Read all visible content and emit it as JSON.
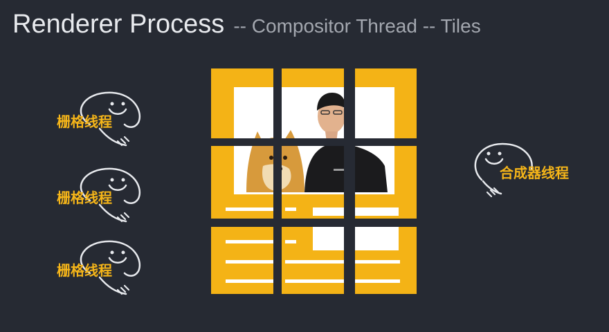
{
  "header": {
    "title": "Renderer Process",
    "subtitle": "-- Compositor Thread -- Tiles"
  },
  "raster_threads": [
    {
      "label": "栅格线程"
    },
    {
      "label": "栅格线程"
    },
    {
      "label": "栅格线程"
    }
  ],
  "compositor": {
    "label": "合成器线程"
  },
  "colors": {
    "background": "#262a33",
    "tile": "#f4b316",
    "content": "#ffffff",
    "label": "#f5b519",
    "doodle": "#e8eaee"
  }
}
